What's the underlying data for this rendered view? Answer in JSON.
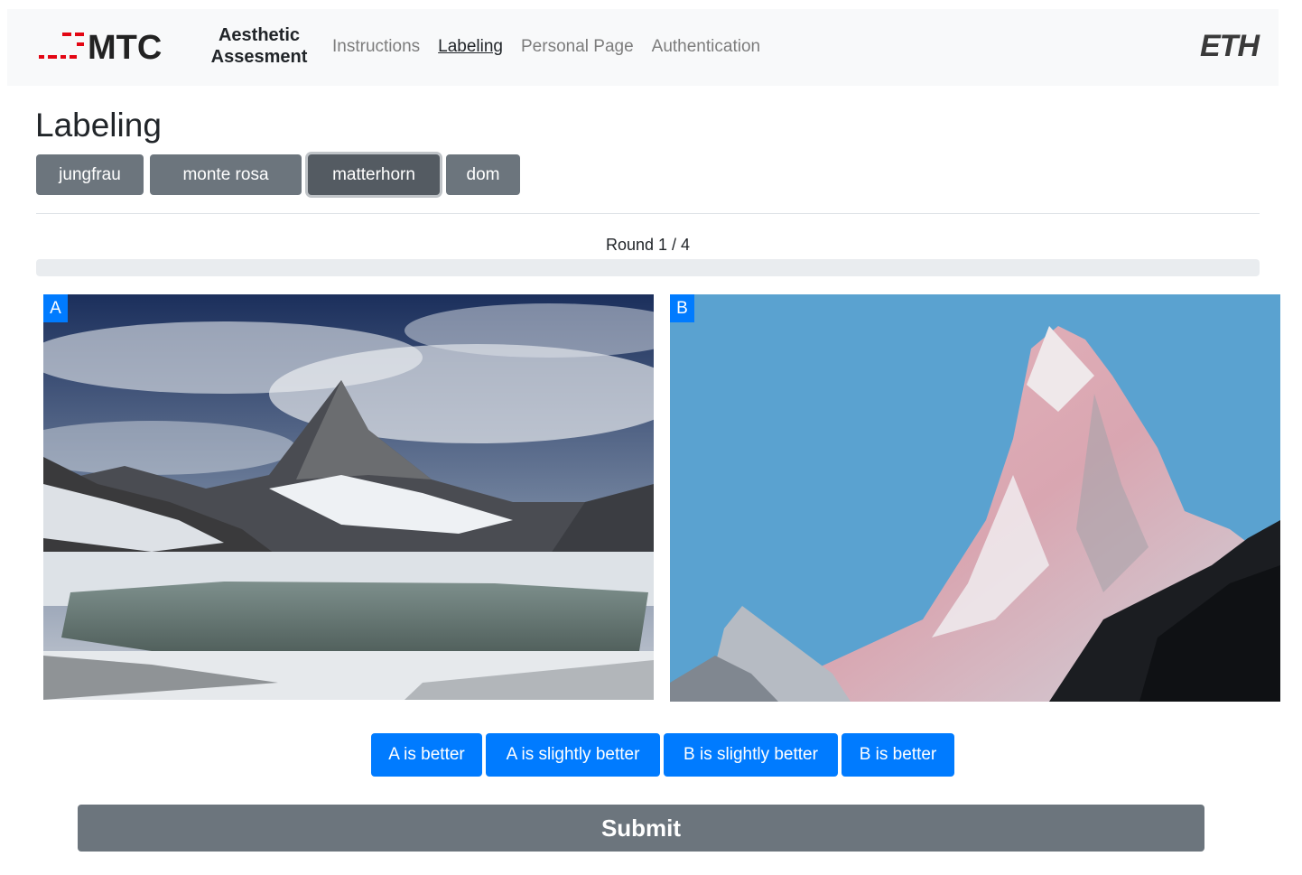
{
  "navbar": {
    "logo_text": "MTC",
    "brand_line1": "Aesthetic",
    "brand_line2": "Assesment",
    "links": [
      {
        "label": "Instructions",
        "active": false
      },
      {
        "label": "Labeling",
        "active": true
      },
      {
        "label": "Personal Page",
        "active": false
      },
      {
        "label": "Authentication",
        "active": false
      }
    ],
    "right_logo": "ETH"
  },
  "page": {
    "title": "Labeling"
  },
  "tabs": [
    {
      "label": "jungfrau",
      "selected": false
    },
    {
      "label": "monte rosa",
      "selected": false
    },
    {
      "label": "matterhorn",
      "selected": true
    },
    {
      "label": "dom",
      "selected": false
    }
  ],
  "progress": {
    "label": "Round 1 / 4",
    "value_fraction": 0.0
  },
  "images": {
    "a_tag": "A",
    "b_tag": "B"
  },
  "choices": [
    {
      "label": "A is better"
    },
    {
      "label": "A is slightly better"
    },
    {
      "label": "B is slightly better"
    },
    {
      "label": "B is better"
    }
  ],
  "submit_label": "Submit",
  "colors": {
    "primary": "#007bff",
    "secondary": "#6c757d",
    "logo_red": "#e30613"
  }
}
